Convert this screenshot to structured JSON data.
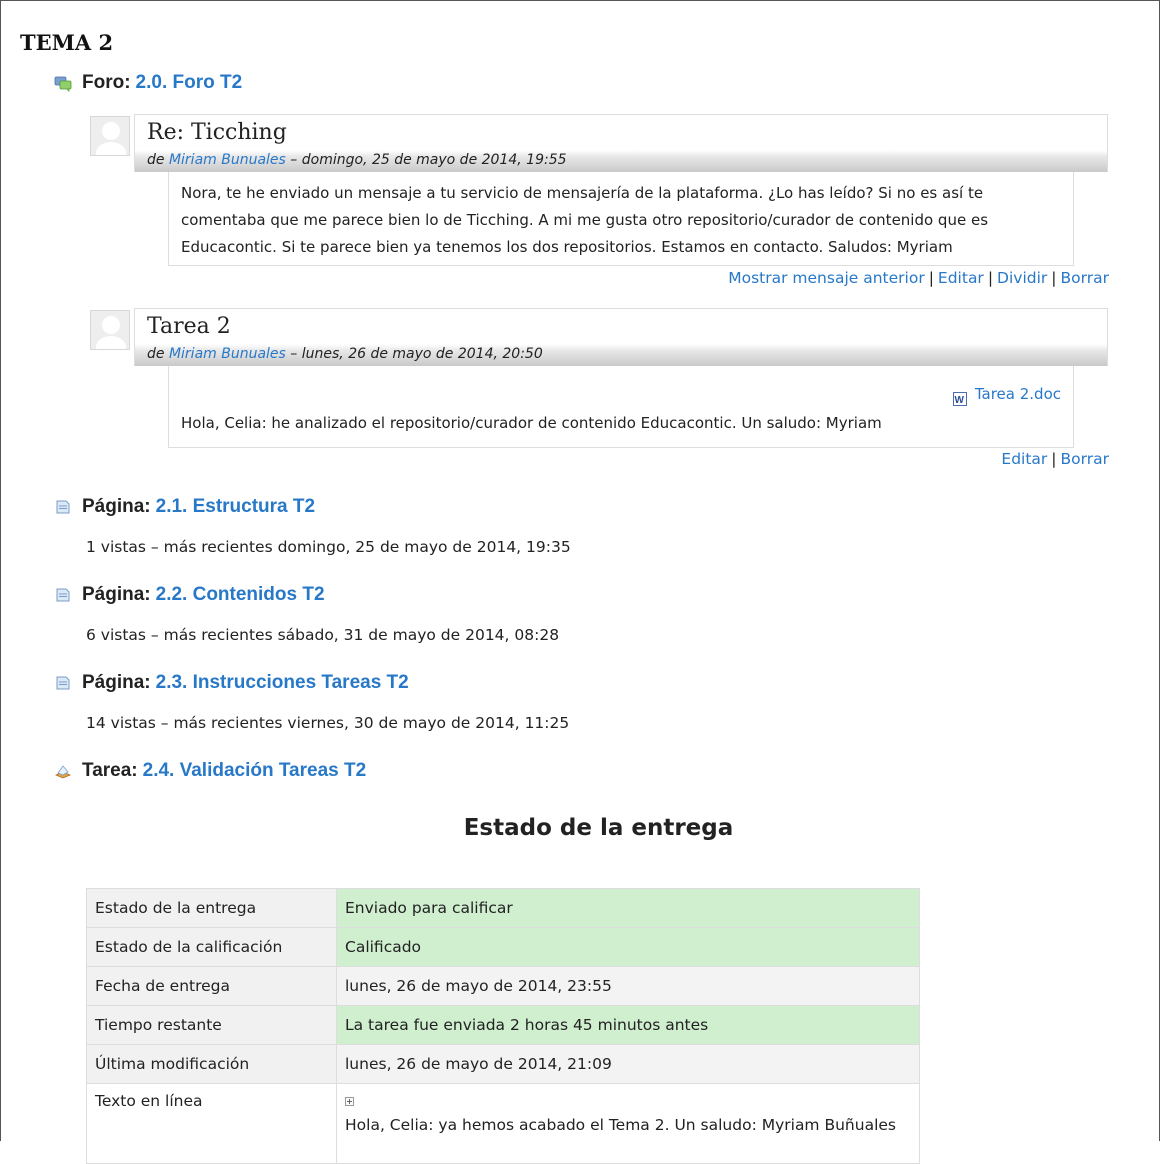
{
  "section": {
    "title": "TEMA 2"
  },
  "forum": {
    "type_label": "Foro:",
    "name": "2.0. Foro T2",
    "icon": "forum-icon",
    "posts": [
      {
        "subject": "Re: Ticching",
        "by_prefix": "de",
        "author": "Miriam Bunuales",
        "date": " – domingo, 25 de mayo de 2014, 19:55",
        "message": "Nora, te he enviado un mensaje a tu servicio de mensajería de la plataforma. ¿Lo has leído? Si no es así te comentaba que me parece bien lo de Ticching. A mi me gusta otro repositorio/curador de contenido que es Educacontic. Si te parece bien ya tenemos los dos repositorios. Estamos en contacto. Saludos: Myriam",
        "links": [
          "Mostrar mensaje anterior",
          "Editar",
          "Dividir",
          "Borrar"
        ]
      },
      {
        "subject": "Tarea 2",
        "by_prefix": "de",
        "author": "Miriam Bunuales",
        "date": " – lunes, 26 de mayo de 2014, 20:50",
        "attachment": "Tarea 2.doc",
        "message": "Hola, Celia: he analizado el repositorio/curador de contenido Educacontic. Un saludo: Myriam",
        "links": [
          "Editar",
          "Borrar"
        ]
      }
    ]
  },
  "pages": [
    {
      "type_label": "Página:",
      "name": "2.1. Estructura T2",
      "views": "1 vistas – más recientes domingo, 25 de mayo de 2014, 19:35"
    },
    {
      "type_label": "Página:",
      "name": "2.2. Contenidos T2",
      "views": "6 vistas – más recientes sábado, 31 de mayo de 2014, 08:28"
    },
    {
      "type_label": "Página:",
      "name": "2.3. Instrucciones Tareas T2",
      "views": "14 vistas – más recientes viernes, 30 de mayo de 2014, 11:25"
    }
  ],
  "assignment": {
    "type_label": "Tarea:",
    "name": "2.4. Validación Tareas T2",
    "status_heading": "Estado de la entrega",
    "rows": [
      {
        "key": "Estado de la entrega",
        "value": "Enviado para calificar",
        "highlight": true
      },
      {
        "key": "Estado de la calificación",
        "value": "Calificado",
        "highlight": true
      },
      {
        "key": "Fecha de entrega",
        "value": "lunes, 26 de mayo de 2014, 23:55",
        "highlight": false
      },
      {
        "key": "Tiempo restante",
        "value": "La tarea fue enviada 2 horas 45 minutos antes",
        "highlight": true
      },
      {
        "key": "Última modificación",
        "value": "lunes, 26 de mayo de 2014, 21:09",
        "highlight": false
      },
      {
        "key": "Texto en línea",
        "value": "Hola, Celia: ya hemos acabado el Tema 2. Un saludo: Myriam Buñuales",
        "highlight": false
      }
    ]
  },
  "colors": {
    "link": "#2878c8",
    "ok_background": "#cfefcf"
  }
}
